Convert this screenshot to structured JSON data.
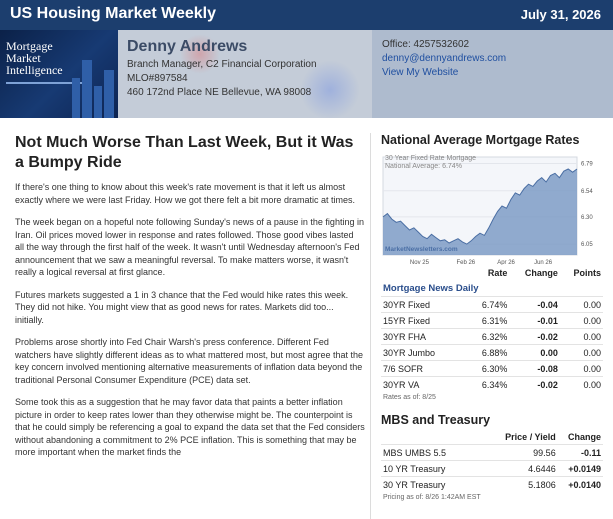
{
  "topbar": {
    "title": "US Housing Market Weekly",
    "date": "July 31, 2026"
  },
  "logo": {
    "line1": "Mortgage",
    "line2": "Market",
    "line3": "Intelligence"
  },
  "agent": {
    "name": "Denny Andrews",
    "role": "Branch Manager, C2 Financial Corporation",
    "nmls": "MLO#897584",
    "address": "460 172nd Place NE Bellevue, WA 98008"
  },
  "contact": {
    "office": "Office: 4257532602",
    "email": "denny@dennyandrews.com",
    "website": "View My Website"
  },
  "article": {
    "headline": "Not Much Worse Than Last Week, But it Was a Bumpy Ride",
    "paragraphs": [
      "If there's one thing to know about this week's rate movement is that it left us almost exactly where we were last Friday. How we got there felt a bit more dramatic at times.",
      "The week began on a hopeful note following Sunday's news of a pause in the fighting in Iran. Oil prices moved lower in response and rates followed. Those good vibes lasted all the way through the first half of the week. It wasn't until Wednesday afternoon's Fed announcement that we saw a meaningful reversal. To make matters worse, it wasn't really a logical reversal at first glance.",
      "Futures markets suggested a 1 in 3 chance that the Fed would hike rates this week. They did not hike. You might view that as good news for rates. Markets did too... initially.",
      "Problems arose shortly into Fed Chair Warsh's press conference. Different Fed watchers have slightly different ideas as to what mattered most, but most agree that the key concern involved mentioning alternative measurements of inflation data beyond the traditional Personal Consumer Expenditure (PCE) data set.",
      "Some took this as a suggestion that he may favor data that paints a better inflation picture in order to keep rates lower than they otherwise might be. The counterpoint is that he could simply be referencing a goal to expand the data set that the Fed considers without abandoning a commitment to 2% PCE inflation. This is something that may be more important when the market finds the"
    ]
  },
  "rates": {
    "title": "National Average Mortgage Rates",
    "chart_data": {
      "type": "line",
      "legend_line1": "30 Year Fixed Rate Mortgage",
      "legend_line2": "National Average: 6.74%",
      "brand": "MarketNewsletters.com",
      "x_ticks": [
        "Nov 25",
        "Feb 26",
        "Apr 26",
        "Jun 26"
      ],
      "y_ticks": [
        "6.79",
        "6.54",
        "6.30",
        "6.05"
      ],
      "ylim": [
        5.95,
        6.85
      ],
      "series": [
        {
          "values": [
            6.3,
            6.33,
            6.28,
            6.25,
            6.26,
            6.22,
            6.18,
            6.2,
            6.16,
            6.12,
            6.1,
            6.14,
            6.11,
            6.08,
            6.09,
            6.06,
            6.08,
            6.1,
            6.07,
            6.05,
            6.08,
            6.12,
            6.15,
            6.13,
            6.2,
            6.28,
            6.35,
            6.4,
            6.38,
            6.46,
            6.52,
            6.5,
            6.56,
            6.6,
            6.58,
            6.63,
            6.66,
            6.62,
            6.68,
            6.7,
            6.66,
            6.72,
            6.74,
            6.71,
            6.74
          ]
        }
      ]
    },
    "table": {
      "headers": [
        "",
        "Rate",
        "Change",
        "Points"
      ],
      "source": "Mortgage News Daily",
      "rows": [
        {
          "label": "30YR Fixed",
          "rate": "6.74%",
          "change": "-0.04",
          "points": "0.00",
          "dir": "pos"
        },
        {
          "label": "15YR Fixed",
          "rate": "6.31%",
          "change": "-0.01",
          "points": "0.00",
          "dir": "pos"
        },
        {
          "label": "30YR FHA",
          "rate": "6.32%",
          "change": "-0.02",
          "points": "0.00",
          "dir": "pos"
        },
        {
          "label": "30YR Jumbo",
          "rate": "6.88%",
          "change": "0.00",
          "points": "0.00",
          "dir": "zero"
        },
        {
          "label": "7/6 SOFR",
          "rate": "6.30%",
          "change": "-0.08",
          "points": "0.00",
          "dir": "pos"
        },
        {
          "label": "30YR VA",
          "rate": "6.34%",
          "change": "-0.02",
          "points": "0.00",
          "dir": "pos"
        }
      ],
      "note": "Rates as of: 8/25"
    }
  },
  "mbs": {
    "title": "MBS and Treasury",
    "headers": [
      "",
      "Price / Yield",
      "Change"
    ],
    "rows": [
      {
        "label": "MBS UMBS 5.5",
        "value": "99.56",
        "change": "-0.11",
        "dir": "neg"
      },
      {
        "label": "10 YR Treasury",
        "value": "4.6446",
        "change": "+0.0149",
        "dir": "neg"
      },
      {
        "label": "30 YR Treasury",
        "value": "5.1806",
        "change": "+0.0140",
        "dir": "neg"
      }
    ],
    "note": "Pricing as of: 8/26 1:42AM EST"
  },
  "colors": {
    "topbar": "#1c3e6e",
    "header": "#c4ccd8",
    "contact_panel": "#aebbce",
    "chart_fill": "#7e9cc6",
    "positive": "#2a9a3e",
    "negative": "#c41f1f"
  }
}
